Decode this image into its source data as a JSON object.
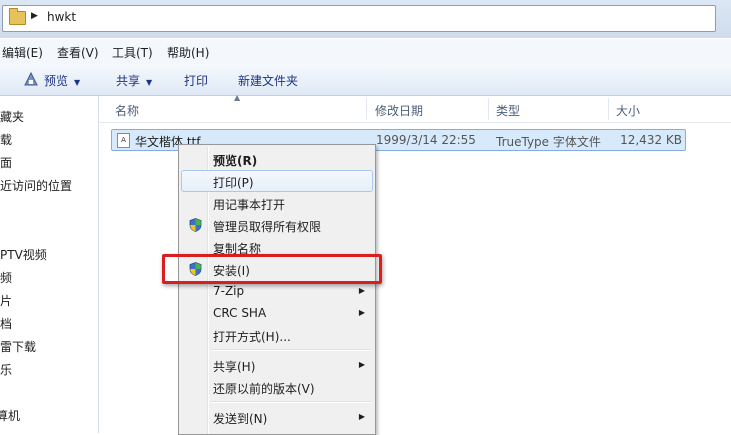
{
  "address": {
    "path": "hwkt"
  },
  "menubar": {
    "items": [
      "编辑(E)",
      "查看(V)",
      "工具(T)",
      "帮助(H)"
    ]
  },
  "toolbar": {
    "preview": "预览",
    "share": "共享",
    "print": "打印",
    "new_folder": "新建文件夹"
  },
  "nav": {
    "items": [
      "藏夹",
      "载",
      "面",
      "近访问的位置",
      "PTV视频",
      "频",
      "片",
      "档",
      "雷下载",
      "乐",
      "算机"
    ]
  },
  "columns": {
    "name": "名称",
    "modified": "修改日期",
    "type": "类型",
    "size": "大小"
  },
  "file": {
    "name": "华文楷体.ttf",
    "modified": "1999/3/14 22:55",
    "type": "TrueType 字体文件",
    "size": "12,432 KB",
    "icon_text": "A"
  },
  "context_menu": {
    "preview": "预览(R)",
    "print": "打印(P)",
    "open_notepad": "用记事本打开",
    "take_ownership": "管理员取得所有权限",
    "copy_name": "复制名称",
    "install": "安装(I)",
    "zip": "7-Zip",
    "crc": "CRC SHA",
    "open_with": "打开方式(H)...",
    "share": "共享(H)",
    "restore": "还原以前的版本(V)",
    "send_to": "发送到(N)"
  },
  "colors": {
    "highlight": "#d81e1e",
    "selection": "#d7eafc",
    "accent": "#1e3287"
  }
}
